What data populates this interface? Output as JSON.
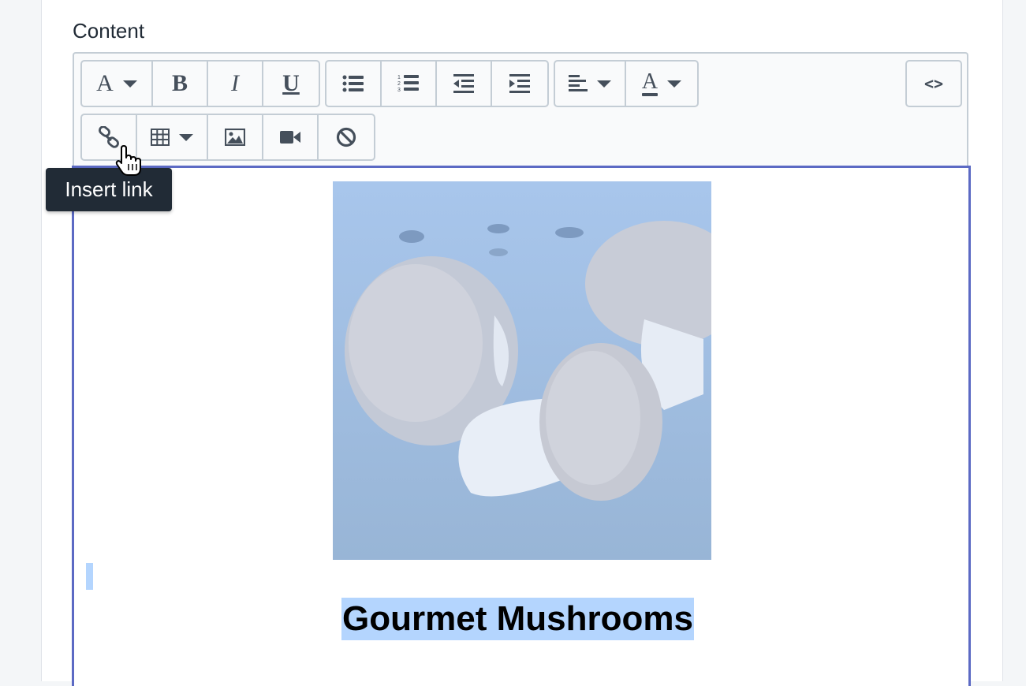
{
  "field": {
    "label": "Content"
  },
  "toolbar": {
    "row1": {
      "format_group": [
        {
          "icon": "text-style-icon",
          "glyph": "A",
          "dropdown": true
        },
        {
          "icon": "bold-icon",
          "glyph": "B"
        },
        {
          "icon": "italic-icon",
          "glyph": "I"
        },
        {
          "icon": "underline-icon",
          "glyph": "U"
        }
      ],
      "list_group": [
        "bulleted-list-icon",
        "numbered-list-icon",
        "outdent-icon",
        "indent-icon"
      ],
      "align_group": [
        {
          "icon": "align-left-icon",
          "dropdown": true
        },
        {
          "icon": "text-color-icon",
          "glyph": "A",
          "dropdown": true
        }
      ],
      "code_label": "<>"
    },
    "row2": {
      "insert_group": [
        {
          "icon": "link-icon"
        },
        {
          "icon": "table-icon",
          "dropdown": true
        },
        {
          "icon": "image-icon"
        },
        {
          "icon": "video-icon"
        },
        {
          "icon": "clear-formatting-icon"
        }
      ]
    }
  },
  "tooltip": {
    "text": "Insert link"
  },
  "editor": {
    "image_subject": "mushrooms-photo",
    "heading": "Gourmet Mushrooms"
  },
  "colors": {
    "focus_border": "#5c6ac4",
    "selection": "#b4d5fe",
    "tooltip_bg": "#212b36",
    "icon": "#454f5b"
  }
}
